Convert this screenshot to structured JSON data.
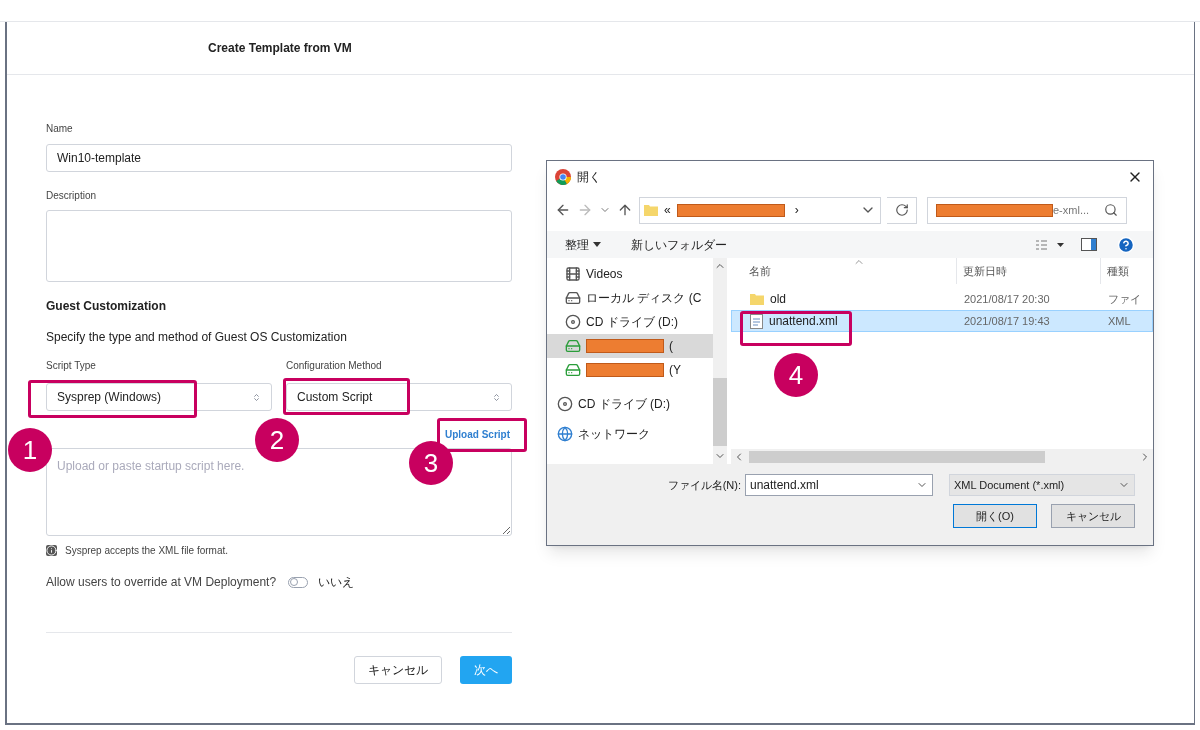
{
  "page": {
    "title": "Create Template from VM"
  },
  "form": {
    "name": {
      "label": "Name",
      "value": "Win10-template"
    },
    "description": {
      "label": "Description"
    },
    "section_title": "Guest Customization",
    "section_subtitle": "Specify the type and method of Guest OS Customization",
    "script_type": {
      "label": "Script Type",
      "value": "Sysprep (Windows)"
    },
    "config_method": {
      "label": "Configuration Method",
      "value": "Custom Script"
    },
    "upload_link": "Upload Script",
    "script": {
      "placeholder": "Upload or paste startup script here."
    },
    "info_note": "Sysprep accepts the XML file format.",
    "override": {
      "label": "Allow users to override at VM Deployment?",
      "on": false,
      "state_text": "いいえ"
    }
  },
  "buttons": [
    {
      "label": "キャンセル",
      "kind": "secondary"
    },
    {
      "label": "次へ",
      "kind": "primary"
    }
  ],
  "dialog": {
    "title": "開く",
    "address": {
      "prefix": "«",
      "suffix": "›"
    },
    "search": {
      "placeholder": "e-xml..."
    },
    "toolbar": {
      "organize": "整理",
      "new_folder": "新しいフォルダー"
    },
    "nav_items": [
      {
        "label": "Videos",
        "kind": "video",
        "selected": false,
        "indent": true
      },
      {
        "label": "ローカル ディスク (C",
        "kind": "drive",
        "selected": false,
        "indent": true
      },
      {
        "label": "CD ドライブ (D:)",
        "kind": "cd",
        "selected": false,
        "indent": true
      },
      {
        "label": "(",
        "kind": "netdrive",
        "redacted": true,
        "selected": true,
        "indent": true
      },
      {
        "label": "(Y",
        "kind": "netdrive",
        "redacted": true,
        "selected": false,
        "indent": true
      },
      {
        "label": "CD ドライブ (D:)",
        "kind": "cd",
        "selected": false,
        "indent": false
      },
      {
        "label": "ネットワーク",
        "kind": "network",
        "selected": false,
        "indent": false
      }
    ],
    "columns": [
      "名前",
      "更新日時",
      "種類"
    ],
    "files": [
      {
        "name": "old",
        "date": "2021/08/17 20:30",
        "type": "ファイ",
        "kind": "folder",
        "selected": false
      },
      {
        "name": "unattend.xml",
        "date": "2021/08/17 19:43",
        "type": "XML",
        "kind": "xml",
        "selected": true
      }
    ],
    "file_name_label": "ファイル名(N):",
    "file_name_value": "unattend.xml",
    "file_type": "XML Document (*.xml)",
    "open_button": "開く(O)",
    "cancel_button": "キャンセル"
  },
  "annotations": [
    {
      "number": "1"
    },
    {
      "number": "2"
    },
    {
      "number": "3"
    },
    {
      "number": "4"
    }
  ]
}
